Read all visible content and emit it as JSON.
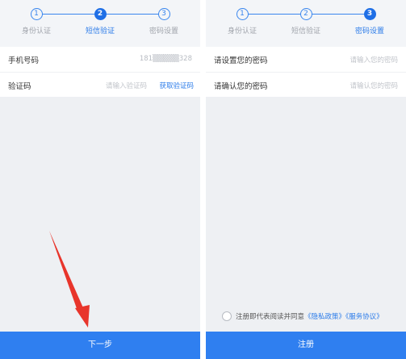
{
  "left": {
    "steps": [
      {
        "num": "1",
        "label": "身份认证"
      },
      {
        "num": "2",
        "label": "短信验证"
      },
      {
        "num": "3",
        "label": "密码设置"
      }
    ],
    "phone_label": "手机号码",
    "phone_value": "181▒▒▒▒▒328",
    "code_label": "验证码",
    "code_placeholder": "请输入验证码",
    "get_code_link": "获取验证码",
    "next_button": "下一步"
  },
  "right": {
    "steps": [
      {
        "num": "1",
        "label": "身份认证"
      },
      {
        "num": "2",
        "label": "短信验证"
      },
      {
        "num": "3",
        "label": "密码设置"
      }
    ],
    "password_label": "请设置您的密码",
    "password_placeholder": "请输入您的密码",
    "confirm_label": "请确认您的密码",
    "confirm_placeholder": "请输认您的密码",
    "agree_text": "注册即代表阅读并同意",
    "privacy_link": "《隐私政策》",
    "service_link": "《服务协议》",
    "register_button": "注册"
  },
  "colors": {
    "accent": "#2f7ff0",
    "arrow": "#e8352b",
    "background": "#eef0f3"
  }
}
